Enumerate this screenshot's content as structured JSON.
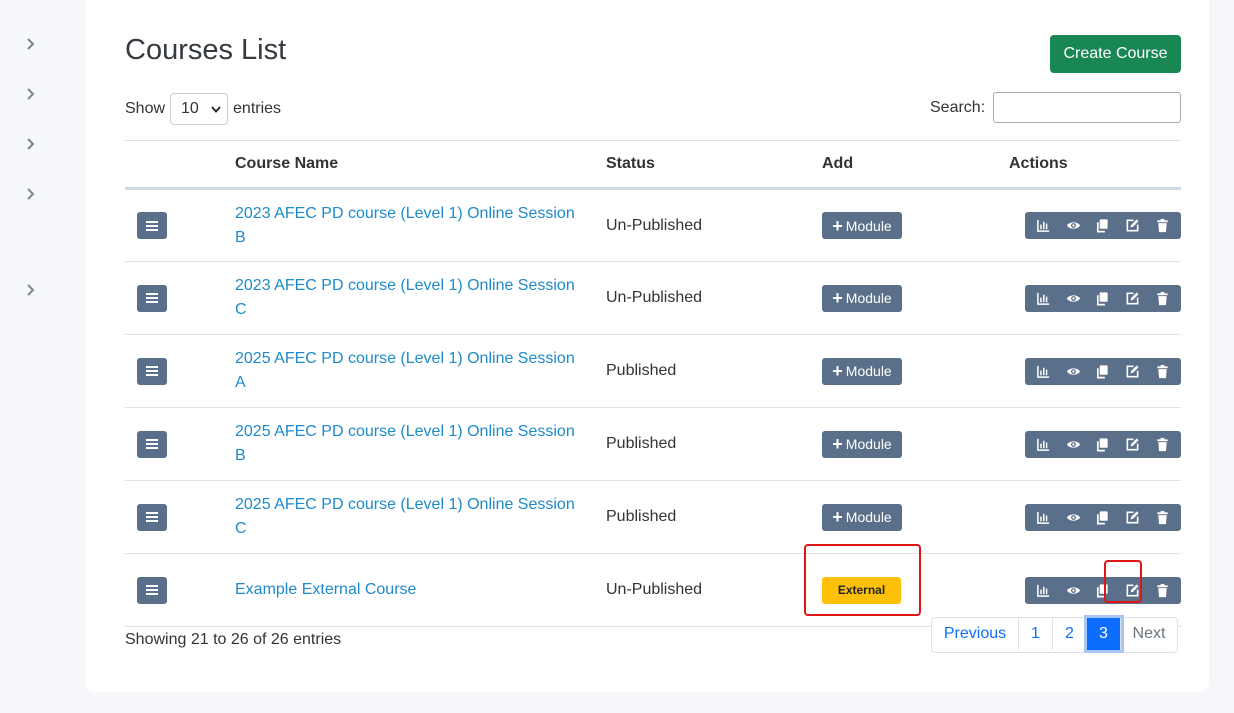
{
  "sidebar": {
    "chevrons": [
      "collapsed",
      "collapsed",
      "collapsed",
      "collapsed",
      "collapsed"
    ]
  },
  "page": {
    "title": "Courses List",
    "create_button": "Create Course"
  },
  "length_control": {
    "show_label": "Show",
    "selected": "10",
    "entries_label": "entries"
  },
  "search": {
    "label": "Search:",
    "value": ""
  },
  "table": {
    "headers": {
      "drag": "",
      "name": "Course Name",
      "status": "Status",
      "add": "Add",
      "actions": "Actions"
    },
    "rows": [
      {
        "name_line1": "2023 AFEC PD course (Level 1) Online Session",
        "name_line2": "B",
        "status": "Un-Published",
        "add_label": "Module",
        "add_type": "module"
      },
      {
        "name_line1": "2023 AFEC PD course (Level 1) Online Session",
        "name_line2": "C",
        "status": "Un-Published",
        "add_label": "Module",
        "add_type": "module"
      },
      {
        "name_line1": "2025 AFEC PD course (Level 1) Online Session",
        "name_line2": "A",
        "status": "Published",
        "add_label": "Module",
        "add_type": "module"
      },
      {
        "name_line1": "2025 AFEC PD course (Level 1) Online Session",
        "name_line2": "B",
        "status": "Published",
        "add_label": "Module",
        "add_type": "module"
      },
      {
        "name_line1": "2025 AFEC PD course (Level 1) Online Session",
        "name_line2": "C",
        "status": "Published",
        "add_label": "Module",
        "add_type": "module"
      },
      {
        "name_line1": "Example External Course",
        "name_line2": "",
        "status": "Un-Published",
        "add_label": "External",
        "add_type": "external"
      }
    ],
    "action_icons": [
      "chart-icon",
      "eye-icon",
      "copy-icon",
      "edit-icon",
      "trash-icon"
    ]
  },
  "footer": {
    "info": "Showing 21 to 26 of 26 entries",
    "pagination": {
      "previous": "Previous",
      "pages": [
        "1",
        "2",
        "3"
      ],
      "current": "3",
      "next": "Next"
    }
  },
  "colors": {
    "accent_green": "#198754",
    "slate_button": "#5a6f89",
    "link_blue": "#1e8ac9",
    "external_yellow": "#ffc107",
    "highlight_red": "#e01515",
    "pager_active": "#0d6efd"
  }
}
